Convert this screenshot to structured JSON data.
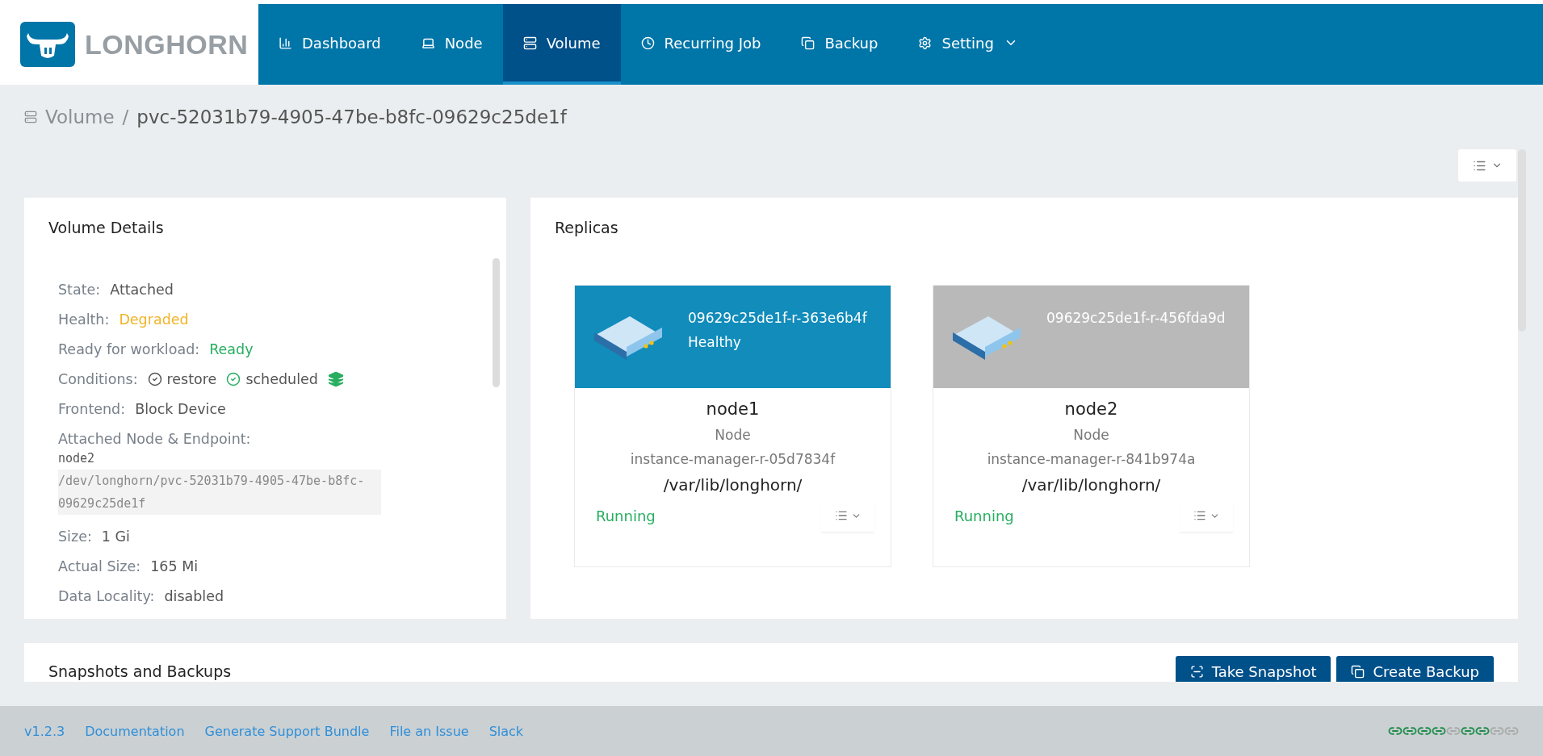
{
  "header": {
    "logo": "LONGHORN",
    "nav": [
      {
        "label": "Dashboard",
        "selected": false,
        "dropdown": false
      },
      {
        "label": "Node",
        "selected": false,
        "dropdown": false
      },
      {
        "label": "Volume",
        "selected": true,
        "dropdown": false
      },
      {
        "label": "Recurring Job",
        "selected": false,
        "dropdown": false
      },
      {
        "label": "Backup",
        "selected": false,
        "dropdown": false
      },
      {
        "label": "Setting",
        "selected": false,
        "dropdown": true
      }
    ]
  },
  "breadcrumb": {
    "parent": "Volume",
    "separator": "/",
    "current": "pvc-52031b79-4905-47be-b8fc-09629c25de1f"
  },
  "volume_details": {
    "title": "Volume Details",
    "items": [
      {
        "kind": "text",
        "label": "State:",
        "value": "Attached"
      },
      {
        "kind": "text",
        "label": "Health:",
        "value": "Degraded",
        "color": "#f1b324"
      },
      {
        "kind": "text",
        "label": "Ready for workload:",
        "value": "Ready",
        "color": "#27ae60"
      },
      {
        "kind": "conditions",
        "label": "Conditions:",
        "conditions": [
          {
            "name": "restore",
            "ok": false
          },
          {
            "name": "scheduled",
            "ok": true
          }
        ]
      },
      {
        "kind": "text",
        "label": "Frontend:",
        "value": "Block Device"
      },
      {
        "kind": "endpoint",
        "label": "Attached Node & Endpoint:",
        "node": "node2",
        "endpoint": "/dev/longhorn/pvc-52031b79-4905-47be-b8fc-09629c25de1f"
      },
      {
        "kind": "text",
        "label": "Size:",
        "value": "1 Gi"
      },
      {
        "kind": "text",
        "label": "Actual Size:",
        "value": "165 Mi"
      },
      {
        "kind": "text",
        "label": "Data Locality:",
        "value": "disabled"
      }
    ]
  },
  "replicas": {
    "title": "Replicas",
    "items": [
      {
        "name": "09629c25de1f-r-363e6b4f",
        "healthy": true,
        "status": "Healthy",
        "node": "node1",
        "node_label": "Node",
        "instance_manager": "instance-manager-r-05d7834f",
        "path": "/var/lib/longhorn/",
        "state": "Running"
      },
      {
        "name": "09629c25de1f-r-456fda9d",
        "healthy": false,
        "node": "node2",
        "node_label": "Node",
        "instance_manager": "instance-manager-r-841b974a",
        "path": "/var/lib/longhorn/",
        "state": "Running"
      }
    ]
  },
  "snapshots": {
    "title": "Snapshots and Backups",
    "buttons": [
      "Take Snapshot",
      "Create Backup"
    ]
  },
  "footer": {
    "links": [
      "v1.2.3",
      "Documentation",
      "Generate Support Bundle",
      "File an Issue",
      "Slack"
    ],
    "connections": [
      {
        "connected": true
      },
      {
        "connected": true
      },
      {
        "connected": true
      },
      {
        "connected": true
      },
      {
        "connected": false
      },
      {
        "connected": true
      },
      {
        "connected": true
      },
      {
        "connected": false
      },
      {
        "connected": false
      }
    ]
  }
}
